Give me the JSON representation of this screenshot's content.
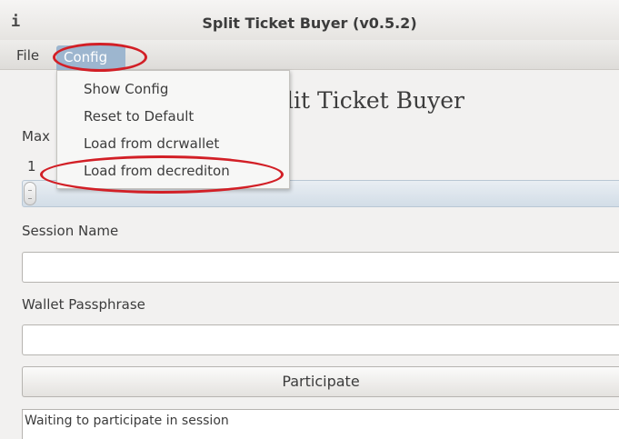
{
  "window": {
    "icon": "info-icon",
    "title": "Split Ticket Buyer (v0.5.2)"
  },
  "menubar": {
    "file_label": "File",
    "config_label": "Config"
  },
  "config_menu": {
    "items": [
      "Show Config",
      "Reset to Default",
      "Load from dcrwallet",
      "Load from decrediton"
    ]
  },
  "main": {
    "heading_partial": "olit Ticket Buyer",
    "max_label_partial": "Max",
    "slider_value": "1",
    "session_name_label": "Session Name",
    "session_name_value": "",
    "wallet_passphrase_label": "Wallet Passphrase",
    "wallet_passphrase_value": "",
    "participate_label": "Participate",
    "status_text": "Waiting to participate in session"
  },
  "colors": {
    "menu_highlight": "#9db6cf",
    "annotation": "#d21f26"
  }
}
